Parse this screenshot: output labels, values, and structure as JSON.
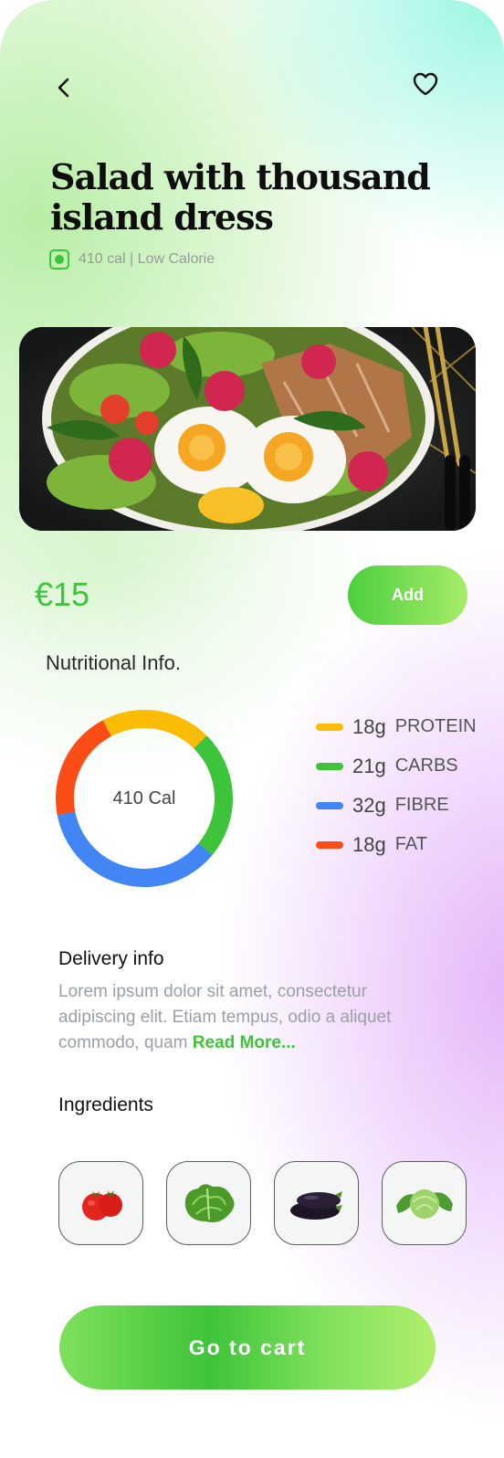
{
  "header": {
    "back_icon": "chevron-left-icon",
    "favorite_icon": "heart-outline-icon"
  },
  "product": {
    "title": "Salad with thousand island dress",
    "calorie_summary": "410 cal | Low Calorie",
    "veg_indicator_color": "#3ec43a",
    "price": "€15",
    "add_label": "Add"
  },
  "nutrition": {
    "heading": "Nutritional Info.",
    "center_label": "410 Cal",
    "items": [
      {
        "amount": "18g",
        "name": "PROTEIN",
        "color": "#fbbc05"
      },
      {
        "amount": "21g",
        "name": "CARBS",
        "color": "#3ec43a"
      },
      {
        "amount": "32g",
        "name": "FIBRE",
        "color": "#4285f4"
      },
      {
        "amount": "18g",
        "name": "FAT",
        "color": "#fc4d17"
      }
    ]
  },
  "delivery": {
    "heading": "Delivery info",
    "body": "Lorem ipsum dolor sit amet, consectetur adipiscing elit. Etiam tempus, odio a aliquet commodo, quam ",
    "read_more": "Read More..."
  },
  "ingredients": {
    "heading": "Ingredients",
    "items": [
      {
        "name": "tomato-icon"
      },
      {
        "name": "lettuce-icon"
      },
      {
        "name": "eggplant-icon"
      },
      {
        "name": "cabbage-icon"
      }
    ]
  },
  "footer": {
    "cart_label": "Go to cart"
  }
}
